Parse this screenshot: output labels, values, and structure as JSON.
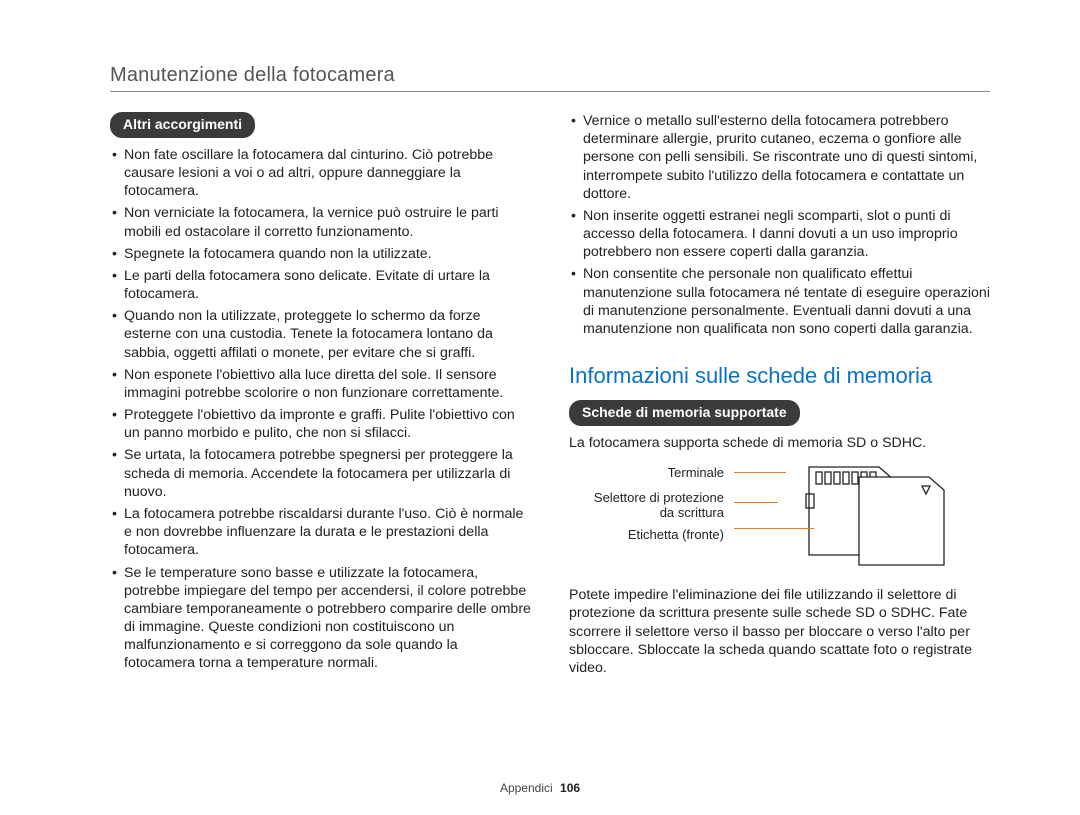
{
  "header": {
    "title": "Manutenzione della fotocamera"
  },
  "left": {
    "pill": "Altri accorgimenti",
    "items": [
      "Non fate oscillare la fotocamera dal cinturino. Ciò potrebbe causare lesioni a voi o ad altri, oppure danneggiare la fotocamera.",
      "Non verniciate la fotocamera, la vernice può ostruire le parti mobili ed ostacolare il corretto funzionamento.",
      "Spegnete la fotocamera quando non la utilizzate.",
      "Le parti della fotocamera sono delicate. Evitate di urtare la fotocamera.",
      "Quando non la utilizzate, proteggete lo schermo da forze esterne con una custodia. Tenete la fotocamera lontano da sabbia, oggetti affilati o monete, per evitare che si graffi.",
      "Non esponete l'obiettivo alla luce diretta del sole. Il sensore immagini potrebbe scolorire o non funzionare correttamente.",
      "Proteggete l'obiettivo da impronte e graffi. Pulite l'obiettivo con un panno morbido e pulito, che non si sfilacci.",
      "Se urtata, la fotocamera potrebbe spegnersi per proteggere la scheda di memoria. Accendete la fotocamera per utilizzarla di nuovo.",
      "La fotocamera potrebbe riscaldarsi durante l'uso. Ciò è normale e non dovrebbe influenzare la durata e le prestazioni della fotocamera.",
      "Se le temperature sono basse e utilizzate la fotocamera, potrebbe impiegare del tempo per accendersi, il colore potrebbe cambiare temporaneamente o potrebbero comparire delle ombre di immagine. Queste condizioni non costituiscono un malfunzionamento e si correggono da sole quando la fotocamera torna a temperature normali."
    ]
  },
  "right": {
    "top_items": [
      "Vernice o metallo sull'esterno della fotocamera potrebbero determinare allergie, prurito cutaneo, eczema o gonfiore alle persone con pelli sensibili. Se riscontrate uno di questi sintomi, interrompete subito l'utilizzo della fotocamera e contattate un dottore.",
      "Non inserite oggetti estranei negli scomparti, slot o punti di accesso della fotocamera. I danni dovuti a un uso improprio potrebbero non essere coperti dalla garanzia.",
      "Non consentite che personale non qualificato effettui manutenzione sulla fotocamera né tentate di eseguire operazioni di manutenzione personalmente. Eventuali danni dovuti a una manutenzione non qualificata non sono coperti dalla garanzia."
    ],
    "section_title": "Informazioni sulle schede di memoria",
    "pill": "Schede di memoria supportate",
    "supported_text": "La fotocamera supporta schede di memoria SD o SDHC.",
    "labels": {
      "terminal": "Terminale",
      "lock_line1": "Selettore di protezione",
      "lock_line2": "da scrittura",
      "front": "Etichetta (fronte)"
    },
    "bottom_text": "Potete impedire l'eliminazione dei file utilizzando il selettore di protezione da scrittura presente sulle schede SD o SDHC. Fate scorrere il selettore verso il basso per bloccare o verso l'alto per sbloccare. Sbloccate la scheda quando scattate foto o registrate video."
  },
  "footer": {
    "section": "Appendici",
    "page": "106"
  }
}
